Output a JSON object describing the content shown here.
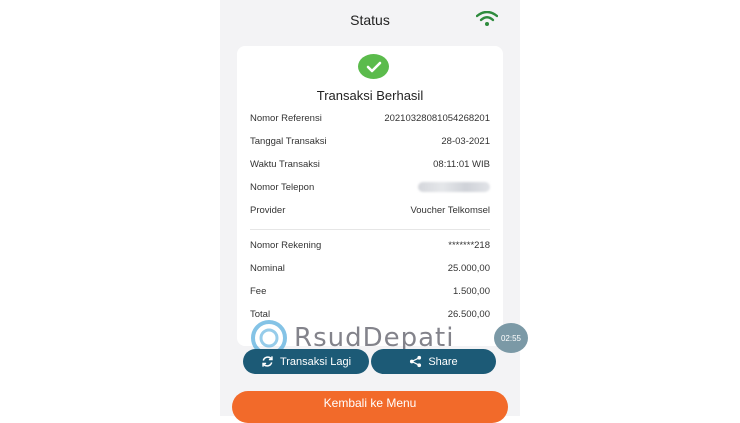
{
  "header": {
    "title": "Status",
    "wifi_icon": "wifi-icon"
  },
  "colors": {
    "success": "#5bbb4c",
    "button_dark": "#1c5a76",
    "button_orange": "#f26a2a"
  },
  "receipt": {
    "heading": "Transaksi Berhasil",
    "rows": [
      {
        "label": "Nomor Referensi",
        "value": "20210328081054268201"
      },
      {
        "label": "Tanggal Transaksi",
        "value": "28-03-2021"
      },
      {
        "label": "Waktu Transaksi",
        "value": "08:11:01 WIB"
      },
      {
        "label": "Nomor Telepon",
        "value": ""
      },
      {
        "label": "Provider",
        "value": "Voucher Telkomsel"
      },
      {
        "label": "Nomor Rekening",
        "value": "*******218"
      },
      {
        "label": "Nominal",
        "value": "25.000,00"
      },
      {
        "label": "Fee",
        "value": "1.500,00"
      },
      {
        "label": "Total",
        "value": "26.500,00"
      }
    ]
  },
  "timer": "02:55",
  "watermark": "RsudDepati",
  "buttons": {
    "again": "Transaksi Lagi",
    "share": "Share",
    "back": "Kembali ke Menu"
  }
}
